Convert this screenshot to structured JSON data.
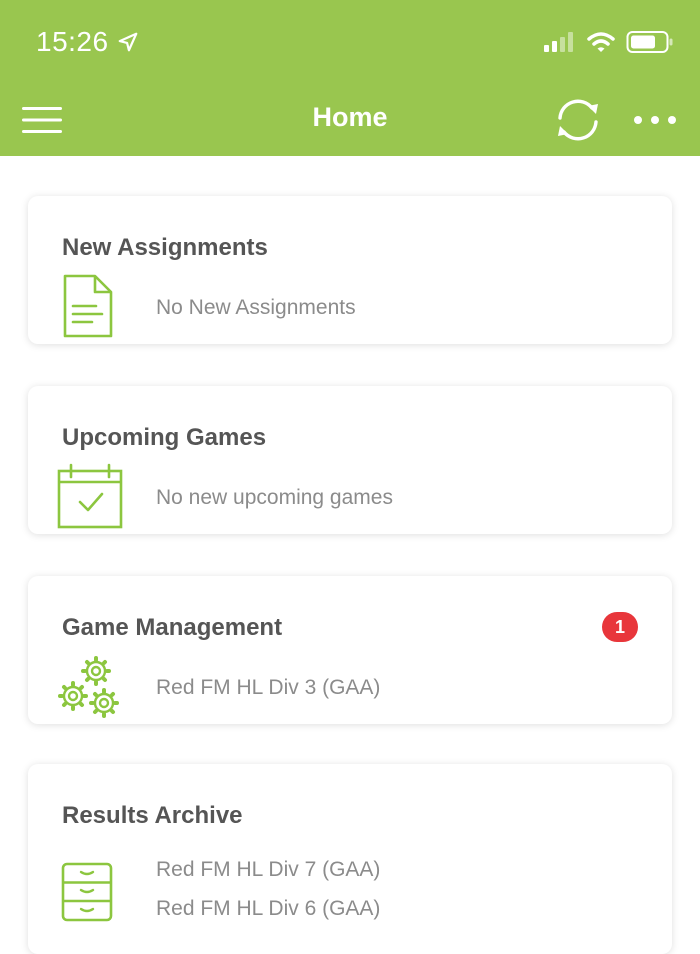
{
  "status_bar": {
    "time": "15:26"
  },
  "nav": {
    "title": "Home"
  },
  "icons": {
    "menu": "hamburger-menu-icon",
    "sync": "sync-icon",
    "more": "more-dots-icon"
  },
  "colors": {
    "brand_green": "#99c64f",
    "icon_green": "#8cc63f",
    "badge_red": "#e8363b",
    "title_gray": "#555555",
    "text_gray": "#8b8b8b"
  },
  "cards": {
    "new_assignments": {
      "title": "New Assignments",
      "lines": [
        "No New Assignments"
      ]
    },
    "upcoming_games": {
      "title": "Upcoming Games",
      "lines": [
        "No new upcoming games"
      ]
    },
    "game_management": {
      "title": "Game Management",
      "badge": "1",
      "lines": [
        "Red FM HL Div 3 (GAA)"
      ]
    },
    "results_archive": {
      "title": "Results Archive",
      "lines": [
        "Red FM HL Div 7 (GAA)",
        "Red FM HL Div 6 (GAA)"
      ]
    }
  }
}
